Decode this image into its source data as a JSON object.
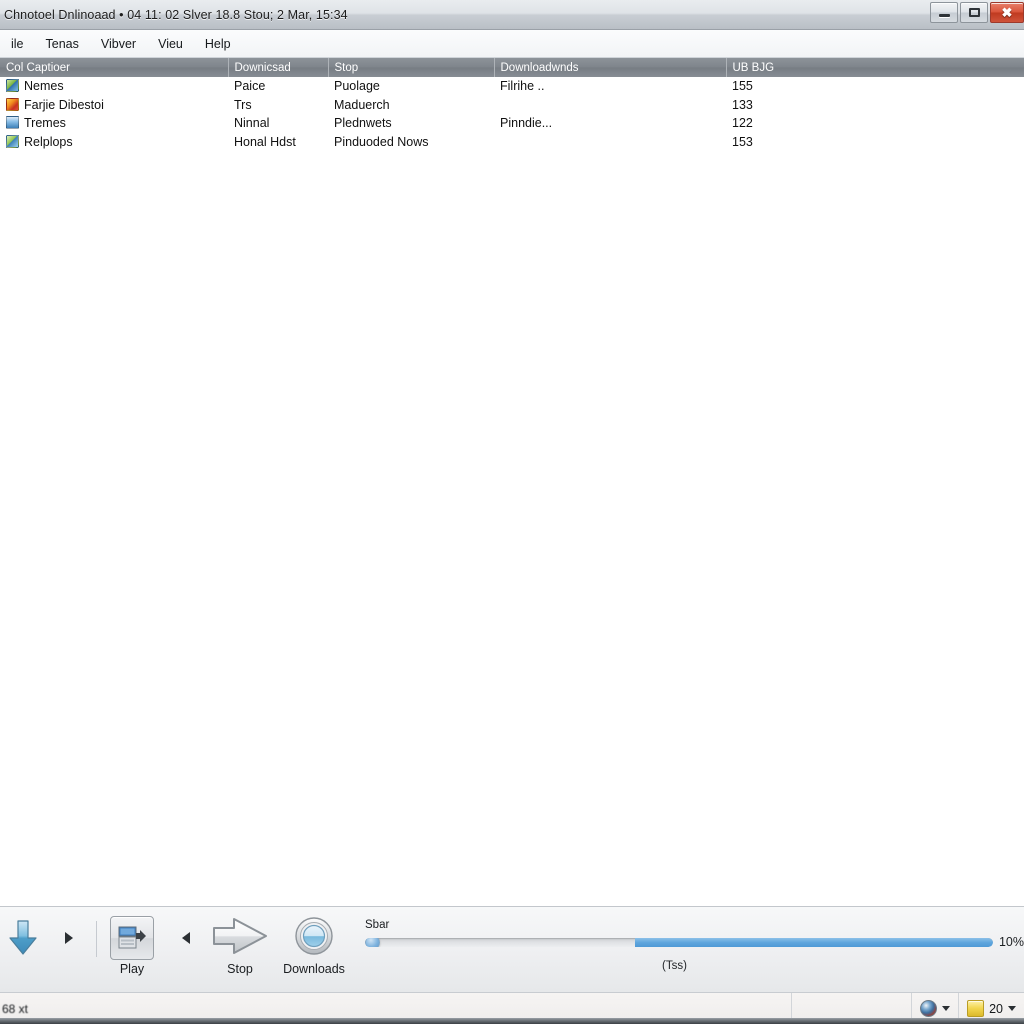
{
  "window": {
    "title": "Chnotoel Dnlinoaad • 04 11: 02 Slver 18.8 Stou; 2 Mar, 15:34",
    "minimize_label": "Minimize",
    "maximize_label": "Maximize",
    "close_label": "Close"
  },
  "menubar": {
    "items": [
      {
        "label": "ile"
      },
      {
        "label": "Tenas"
      },
      {
        "label": "Vibver"
      },
      {
        "label": "Vieu"
      },
      {
        "label": "Help"
      }
    ]
  },
  "list": {
    "columns": [
      {
        "label": "Col Captioer"
      },
      {
        "label": "Downicsad"
      },
      {
        "label": "Stop"
      },
      {
        "label": "Downloadwnds"
      },
      {
        "label": "UB BJG"
      }
    ],
    "rows": [
      {
        "icon": "image-file-icon",
        "icon_class": "ic-green",
        "caption": "Nemes",
        "download": "Paice",
        "stop": "Puolage",
        "downloads": "Filrihe ..",
        "size": "155"
      },
      {
        "icon": "archive-file-icon",
        "icon_class": "ic-red",
        "caption": "Farjie Dibestoi",
        "download": "Trs",
        "stop": "Maduerch",
        "downloads": "",
        "size": "133"
      },
      {
        "icon": "document-file-icon",
        "icon_class": "ic-blue",
        "caption": "Tremes",
        "download": "Ninnal",
        "stop": "Plednwets",
        "downloads": "Pinndie...",
        "size": "122"
      },
      {
        "icon": "image-file-icon",
        "icon_class": "ic-green2",
        "caption": "Relplops",
        "download": "Honal Hdst",
        "stop": "Pinduoded Nows",
        "downloads": "",
        "size": "153"
      }
    ]
  },
  "toolbar": {
    "download_arrow_label": "download-arrow",
    "next_label": "next",
    "prev_label": "previous",
    "buttons": [
      {
        "label": "Play",
        "icon": "play-window-icon"
      },
      {
        "label": "Stop",
        "icon": "stop-diamond-icon"
      },
      {
        "label": "Downloads",
        "icon": "downloads-circle-icon"
      }
    ]
  },
  "progress": {
    "label": "Sbar",
    "percent_text": "10%",
    "percent_value": 10,
    "fill_start_pct": 43,
    "sub_label": "(Tss)"
  },
  "statusbar": {
    "message": "68 xt",
    "globe_icon": "globe-icon",
    "folder_icon": "folder-icon",
    "zoom_value": "20"
  },
  "colors": {
    "accent_blue": "#4e99d6",
    "header_gray": "#7e848b",
    "close_red": "#bf3a20"
  }
}
